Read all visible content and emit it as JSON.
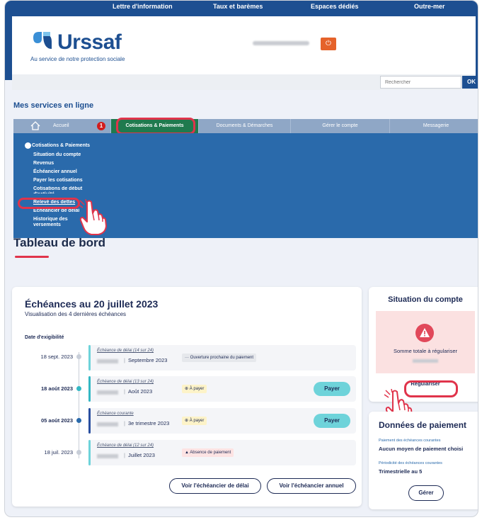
{
  "topnav": [
    "Lettre d'information",
    "Taux et barèmes",
    "Espaces dédiés",
    "Outre-mer"
  ],
  "logo": {
    "name": "Urssaf",
    "tagline": "Au service de notre protection sociale"
  },
  "search": {
    "placeholder": "Rechercher",
    "button": "OK"
  },
  "services": {
    "title": "Mes services en ligne",
    "tabs": [
      "Accueil",
      "Cotisations & Paiements",
      "Documents & Démarches",
      "Gérer le compte",
      "Messagerie"
    ],
    "notification_count": "1",
    "dropdown": {
      "heading": "Cotisations & Paiements",
      "items": [
        "Situation du compte",
        "Revenus",
        "Échéancier annuel",
        "Payer les cotisations",
        "Cotisations de début d'activité",
        "Relevé des dettes",
        "Échéancier de délai",
        "Historique des versements"
      ]
    }
  },
  "dashboard": {
    "title": "Tableau de bord",
    "echeances": {
      "title": "Échéances au 20 juillet 2023",
      "subtitle": "Visualisation des 4 dernières échéances",
      "col_header": "Date d'exigibilité",
      "rows": [
        {
          "date": "18 sept. 2023",
          "type": "Échéance de délai (14 sur 24)",
          "period": "Septembre 2023",
          "badge": "··· Ouverture prochaine du paiement",
          "action": ""
        },
        {
          "date": "18 août 2023",
          "type": "Échéance de délai (13 sur 24)",
          "period": "Août 2023",
          "badge": "⊕ À payer",
          "action": "Payer"
        },
        {
          "date": "05 août 2023",
          "type": "Échéance courante",
          "period": "3e trimestre 2023",
          "badge": "⊕ À payer",
          "action": "Payer"
        },
        {
          "date": "18 juil. 2023",
          "type": "Échéance de délai (12 sur 24)",
          "period": "Juillet 2023",
          "badge": "▲ Absence de paiement",
          "action": ""
        }
      ],
      "btn_delai": "Voir l'échéancier de délai",
      "btn_annuel": "Voir l'échéancier annuel"
    },
    "situation": {
      "title": "Situation du compte",
      "label": "Somme totale à régulariser",
      "button": "Régulariser"
    },
    "paiement": {
      "title": "Données de paiement",
      "label1": "Paiement des échéances courantes",
      "value1": "Aucun moyen de paiement choisi",
      "label2": "Périodicité des échéances courantes",
      "value2": "Trimestrielle au 5",
      "button": "Gérer"
    }
  },
  "colors": {
    "brand": "#1d4f91",
    "highlight": "#e0344b",
    "active_tab": "#1f7a4e",
    "pay": "#6ed3da"
  }
}
